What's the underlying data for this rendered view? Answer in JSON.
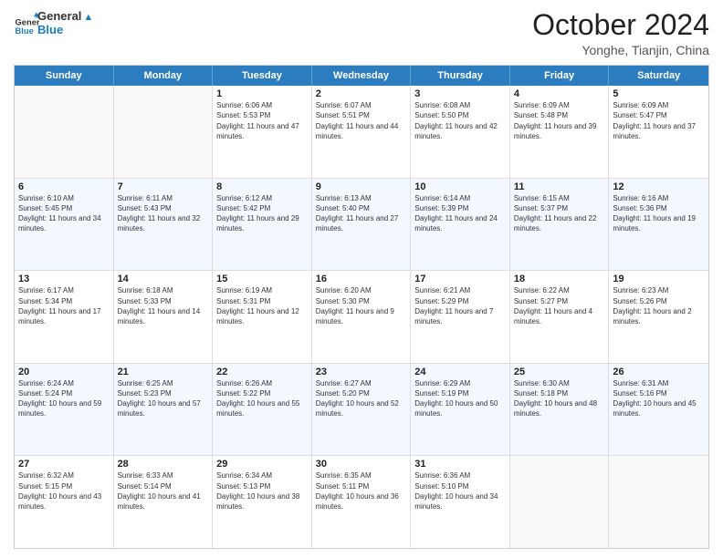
{
  "header": {
    "logo_line1": "General",
    "logo_line2": "Blue",
    "title": "October 2024",
    "subtitle": "Yonghe, Tianjin, China"
  },
  "days_of_week": [
    "Sunday",
    "Monday",
    "Tuesday",
    "Wednesday",
    "Thursday",
    "Friday",
    "Saturday"
  ],
  "weeks": [
    [
      {
        "day": "",
        "info": ""
      },
      {
        "day": "",
        "info": ""
      },
      {
        "day": "1",
        "info": "Sunrise: 6:06 AM\nSunset: 5:53 PM\nDaylight: 11 hours and 47 minutes."
      },
      {
        "day": "2",
        "info": "Sunrise: 6:07 AM\nSunset: 5:51 PM\nDaylight: 11 hours and 44 minutes."
      },
      {
        "day": "3",
        "info": "Sunrise: 6:08 AM\nSunset: 5:50 PM\nDaylight: 11 hours and 42 minutes."
      },
      {
        "day": "4",
        "info": "Sunrise: 6:09 AM\nSunset: 5:48 PM\nDaylight: 11 hours and 39 minutes."
      },
      {
        "day": "5",
        "info": "Sunrise: 6:09 AM\nSunset: 5:47 PM\nDaylight: 11 hours and 37 minutes."
      }
    ],
    [
      {
        "day": "6",
        "info": "Sunrise: 6:10 AM\nSunset: 5:45 PM\nDaylight: 11 hours and 34 minutes."
      },
      {
        "day": "7",
        "info": "Sunrise: 6:11 AM\nSunset: 5:43 PM\nDaylight: 11 hours and 32 minutes."
      },
      {
        "day": "8",
        "info": "Sunrise: 6:12 AM\nSunset: 5:42 PM\nDaylight: 11 hours and 29 minutes."
      },
      {
        "day": "9",
        "info": "Sunrise: 6:13 AM\nSunset: 5:40 PM\nDaylight: 11 hours and 27 minutes."
      },
      {
        "day": "10",
        "info": "Sunrise: 6:14 AM\nSunset: 5:39 PM\nDaylight: 11 hours and 24 minutes."
      },
      {
        "day": "11",
        "info": "Sunrise: 6:15 AM\nSunset: 5:37 PM\nDaylight: 11 hours and 22 minutes."
      },
      {
        "day": "12",
        "info": "Sunrise: 6:16 AM\nSunset: 5:36 PM\nDaylight: 11 hours and 19 minutes."
      }
    ],
    [
      {
        "day": "13",
        "info": "Sunrise: 6:17 AM\nSunset: 5:34 PM\nDaylight: 11 hours and 17 minutes."
      },
      {
        "day": "14",
        "info": "Sunrise: 6:18 AM\nSunset: 5:33 PM\nDaylight: 11 hours and 14 minutes."
      },
      {
        "day": "15",
        "info": "Sunrise: 6:19 AM\nSunset: 5:31 PM\nDaylight: 11 hours and 12 minutes."
      },
      {
        "day": "16",
        "info": "Sunrise: 6:20 AM\nSunset: 5:30 PM\nDaylight: 11 hours and 9 minutes."
      },
      {
        "day": "17",
        "info": "Sunrise: 6:21 AM\nSunset: 5:29 PM\nDaylight: 11 hours and 7 minutes."
      },
      {
        "day": "18",
        "info": "Sunrise: 6:22 AM\nSunset: 5:27 PM\nDaylight: 11 hours and 4 minutes."
      },
      {
        "day": "19",
        "info": "Sunrise: 6:23 AM\nSunset: 5:26 PM\nDaylight: 11 hours and 2 minutes."
      }
    ],
    [
      {
        "day": "20",
        "info": "Sunrise: 6:24 AM\nSunset: 5:24 PM\nDaylight: 10 hours and 59 minutes."
      },
      {
        "day": "21",
        "info": "Sunrise: 6:25 AM\nSunset: 5:23 PM\nDaylight: 10 hours and 57 minutes."
      },
      {
        "day": "22",
        "info": "Sunrise: 6:26 AM\nSunset: 5:22 PM\nDaylight: 10 hours and 55 minutes."
      },
      {
        "day": "23",
        "info": "Sunrise: 6:27 AM\nSunset: 5:20 PM\nDaylight: 10 hours and 52 minutes."
      },
      {
        "day": "24",
        "info": "Sunrise: 6:29 AM\nSunset: 5:19 PM\nDaylight: 10 hours and 50 minutes."
      },
      {
        "day": "25",
        "info": "Sunrise: 6:30 AM\nSunset: 5:18 PM\nDaylight: 10 hours and 48 minutes."
      },
      {
        "day": "26",
        "info": "Sunrise: 6:31 AM\nSunset: 5:16 PM\nDaylight: 10 hours and 45 minutes."
      }
    ],
    [
      {
        "day": "27",
        "info": "Sunrise: 6:32 AM\nSunset: 5:15 PM\nDaylight: 10 hours and 43 minutes."
      },
      {
        "day": "28",
        "info": "Sunrise: 6:33 AM\nSunset: 5:14 PM\nDaylight: 10 hours and 41 minutes."
      },
      {
        "day": "29",
        "info": "Sunrise: 6:34 AM\nSunset: 5:13 PM\nDaylight: 10 hours and 38 minutes."
      },
      {
        "day": "30",
        "info": "Sunrise: 6:35 AM\nSunset: 5:11 PM\nDaylight: 10 hours and 36 minutes."
      },
      {
        "day": "31",
        "info": "Sunrise: 6:36 AM\nSunset: 5:10 PM\nDaylight: 10 hours and 34 minutes."
      },
      {
        "day": "",
        "info": ""
      },
      {
        "day": "",
        "info": ""
      }
    ]
  ]
}
